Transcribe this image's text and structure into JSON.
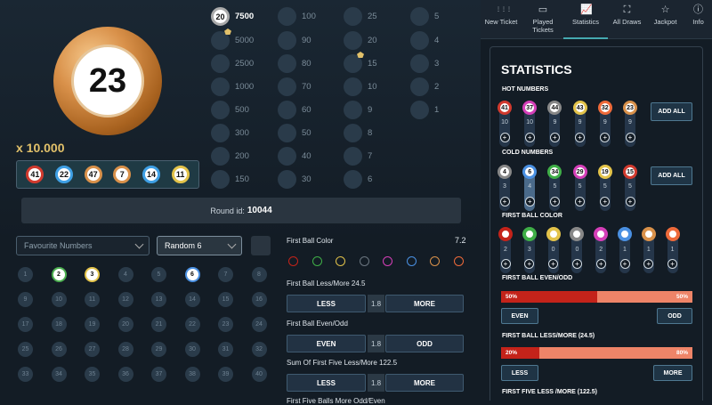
{
  "main": {
    "current_ball": "23",
    "multiplier": "x 10.000",
    "drawn_balls": [
      {
        "n": "41",
        "color": "#d13a2e"
      },
      {
        "n": "22",
        "color": "#3fa0e5"
      },
      {
        "n": "47",
        "color": "#d9914a"
      },
      {
        "n": "7",
        "color": "#d9914a"
      },
      {
        "n": "14",
        "color": "#3fa0e5"
      },
      {
        "n": "11",
        "color": "#e3c34a"
      }
    ],
    "payout_columns": [
      [
        {
          "v": "7500",
          "hit": true,
          "ball": "20"
        },
        {
          "v": "5000",
          "star": true
        },
        {
          "v": "2500"
        },
        {
          "v": "1000"
        },
        {
          "v": "500"
        },
        {
          "v": "300"
        },
        {
          "v": "200"
        },
        {
          "v": "150"
        }
      ],
      [
        {
          "v": "100"
        },
        {
          "v": "90"
        },
        {
          "v": "80"
        },
        {
          "v": "70"
        },
        {
          "v": "60"
        },
        {
          "v": "50"
        },
        {
          "v": "40"
        },
        {
          "v": "30"
        }
      ],
      [
        {
          "v": "25"
        },
        {
          "v": "20"
        },
        {
          "v": "15",
          "star": true
        },
        {
          "v": "10"
        },
        {
          "v": "9"
        },
        {
          "v": "8"
        },
        {
          "v": "7"
        },
        {
          "v": "6"
        }
      ],
      [
        {
          "v": "5"
        },
        {
          "v": "4"
        },
        {
          "v": "3"
        },
        {
          "v": "2"
        },
        {
          "v": "1"
        }
      ]
    ],
    "round_label": "Round id:",
    "round_id": "10044",
    "favourite_placeholder": "Favourite Numbers",
    "random_label": "Random 6",
    "grid_numbers": [
      "1",
      "2",
      "3",
      "4",
      "5",
      "6",
      "7",
      "8",
      "9",
      "10",
      "11",
      "12",
      "13",
      "14",
      "15",
      "16",
      "17",
      "18",
      "19",
      "20",
      "21",
      "22",
      "23",
      "24",
      "25",
      "26",
      "27",
      "28",
      "29",
      "30",
      "31",
      "32",
      "33",
      "34",
      "35",
      "36",
      "37",
      "38",
      "39",
      "40"
    ],
    "grid_selected": {
      "2": "sel1",
      "3": "sel2",
      "6": "sel3"
    },
    "bets": {
      "first_ball_color": {
        "label": "First Ball Color",
        "odds": "7.2",
        "colors": [
          "#c4231a",
          "#3fae47",
          "#e3c34a",
          "#6b7680",
          "#d53fb8",
          "#4a90e2",
          "#d9914a",
          "#ee6a3a"
        ]
      },
      "less_more": {
        "label": "First Ball Less/More 24.5",
        "left": "LESS",
        "odds": "1.8",
        "right": "MORE"
      },
      "even_odd": {
        "label": "First Ball Even/Odd",
        "left": "EVEN",
        "odds": "1.8",
        "right": "ODD"
      },
      "sum_five": {
        "label": "Sum Of First Five Less/More 122.5",
        "left": "LESS",
        "odds": "1.8",
        "right": "MORE"
      },
      "partial_label": "First Five Balls More Odd/Even"
    }
  },
  "topnav": {
    "tabs": [
      {
        "label": "New Ticket",
        "icon": "grid-icon"
      },
      {
        "label": "Played Tickets",
        "icon": "ticket-icon"
      },
      {
        "label": "Statistics",
        "icon": "chart-icon",
        "active": true
      },
      {
        "label": "All Draws",
        "icon": "draws-icon"
      },
      {
        "label": "Jackpot",
        "icon": "star-icon"
      },
      {
        "label": "Info",
        "icon": "info-icon"
      }
    ]
  },
  "statistics": {
    "title": "STATISTICS",
    "hot_label": "HOT NUMBERS",
    "hot": [
      {
        "n": "41",
        "c": "#d13a2e",
        "count": "10",
        "level": 0.8
      },
      {
        "n": "37",
        "c": "#d53fb8",
        "count": "10",
        "level": 0.8
      },
      {
        "n": "44",
        "c": "#888888",
        "count": "9",
        "level": 0.8
      },
      {
        "n": "43",
        "c": "#e3c34a",
        "count": "9",
        "level": 0.8
      },
      {
        "n": "32",
        "c": "#ee6a3a",
        "count": "9",
        "level": 0.8
      },
      {
        "n": "23",
        "c": "#d9914a",
        "count": "9",
        "level": 0.8
      }
    ],
    "cold_label": "COLD NUMBERS",
    "cold": [
      {
        "n": "4",
        "c": "#888888",
        "count": "3"
      },
      {
        "n": "6",
        "c": "#4a90e2",
        "count": "4",
        "active": true
      },
      {
        "n": "34",
        "c": "#3fae47",
        "count": "5"
      },
      {
        "n": "29",
        "c": "#d53fb8",
        "count": "5"
      },
      {
        "n": "19",
        "c": "#e3c34a",
        "count": "5"
      },
      {
        "n": "15",
        "c": "#d13a2e",
        "count": "5"
      }
    ],
    "add_all": "ADD ALL",
    "color_label": "FIRST BALL COLOR",
    "colors": [
      {
        "c": "#c4231a",
        "count": "2"
      },
      {
        "c": "#3fae47",
        "count": "3"
      },
      {
        "c": "#e3c34a",
        "count": "0"
      },
      {
        "c": "#888888",
        "count": "0"
      },
      {
        "c": "#d53fb8",
        "count": "2"
      },
      {
        "c": "#4a90e2",
        "count": "1"
      },
      {
        "c": "#d9914a",
        "count": "1"
      },
      {
        "c": "#ee6a3a",
        "count": "1"
      }
    ],
    "even_odd_label": "FIRST BALL EVEN/ODD",
    "even_pct": "50%",
    "odd_pct": "50%",
    "even": "EVEN",
    "odd": "ODD",
    "less_more_label": "FIRST BALL LESS/MORE (24.5)",
    "less_pct": "20%",
    "more_pct": "80%",
    "less": "LESS",
    "more": "MORE",
    "five_label": "FIRST FIVE LESS /MORE (122.5)"
  }
}
